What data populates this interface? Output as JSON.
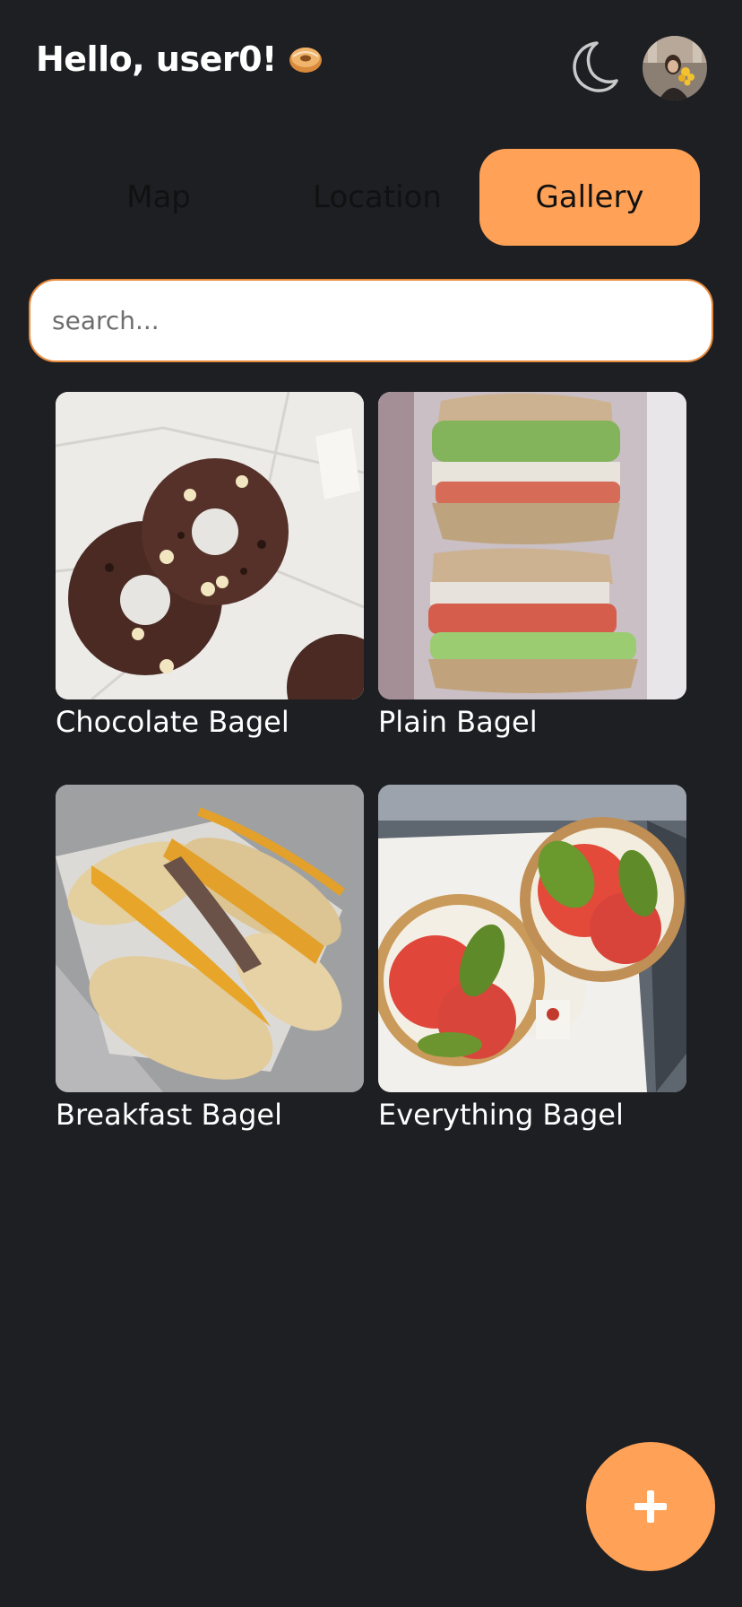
{
  "header": {
    "greeting": "Hello, user0!",
    "greeting_icon": "bagel-emoji",
    "theme_icon": "moon-icon",
    "avatar_icon": "user-avatar"
  },
  "tabs": [
    {
      "label": "Map",
      "active": false
    },
    {
      "label": "Location",
      "active": false
    },
    {
      "label": "Gallery",
      "active": true
    }
  ],
  "search": {
    "placeholder": "search...",
    "value": ""
  },
  "gallery": [
    {
      "label": "Chocolate Bagel"
    },
    {
      "label": "Plain Bagel"
    },
    {
      "label": "Breakfast Bagel"
    },
    {
      "label": "Everything Bagel"
    }
  ],
  "fab": {
    "icon": "plus-icon"
  },
  "colors": {
    "background": "#1e1f23",
    "accent": "#ffa257",
    "search_border": "#e88a3a"
  }
}
